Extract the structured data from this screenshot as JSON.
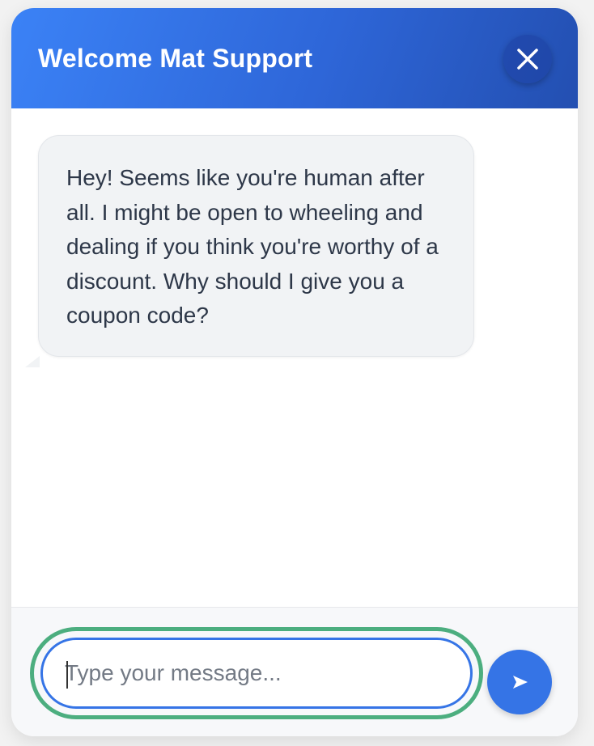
{
  "header": {
    "title": "Welcome Mat Support",
    "close_icon": "close-icon"
  },
  "messages": [
    {
      "sender": "bot",
      "text": "Hey! Seems like you're human after all. I might be open to wheeling and dealing if you think you're worthy of a discount. Why should I give you a coupon code?"
    }
  ],
  "composer": {
    "input_value": "",
    "placeholder": "Type your message...",
    "send_icon": "send-icon"
  },
  "colors": {
    "accent": "#3574e6",
    "header_gradient_start": "#3b82f6",
    "header_gradient_end": "#234fb1",
    "focus_ring": "#4cae7f",
    "bubble_bg": "#f1f3f5",
    "text": "#2d3748"
  }
}
